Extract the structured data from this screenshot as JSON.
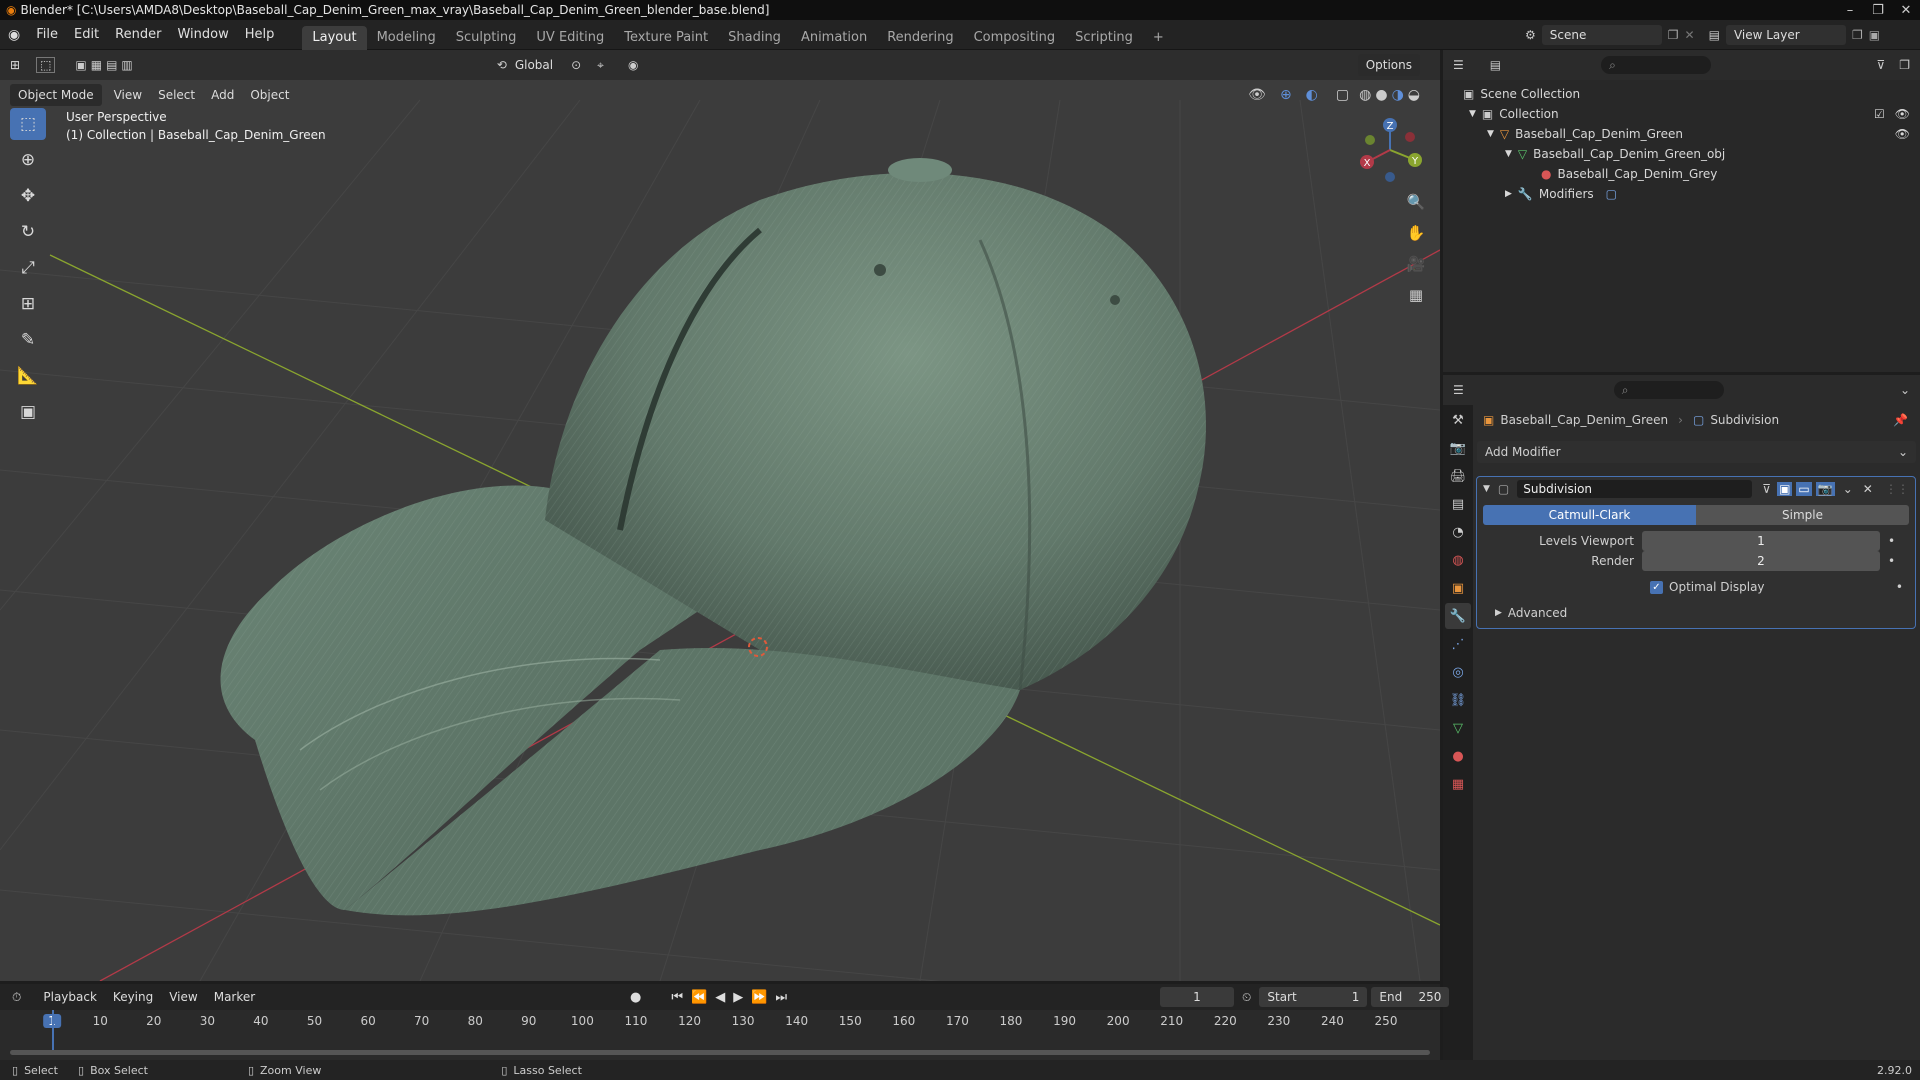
{
  "window": {
    "title": "Blender* [C:\\Users\\AMDA8\\Desktop\\Baseball_Cap_Denim_Green_max_vray\\Baseball_Cap_Denim_Green_blender_base.blend]",
    "controls": [
      "–",
      "❐",
      "✕"
    ]
  },
  "menu": {
    "items": [
      "File",
      "Edit",
      "Render",
      "Window",
      "Help"
    ]
  },
  "workspaces": {
    "tabs": [
      "Layout",
      "Modeling",
      "Sculpting",
      "UV Editing",
      "Texture Paint",
      "Shading",
      "Animation",
      "Rendering",
      "Compositing",
      "Scripting"
    ],
    "active": "Layout",
    "add_symbol": "+"
  },
  "scene": {
    "name": "Scene",
    "view_layer": "View Layer"
  },
  "viewport": {
    "mode": "Object Mode",
    "menus": [
      "View",
      "Select",
      "Add",
      "Object"
    ],
    "transform_orientation": "Global",
    "options_label": "Options",
    "overlay_title": "User Perspective",
    "overlay_subtitle": "(1) Collection | Baseball_Cap_Denim_Green",
    "gizmo": {
      "x": "X",
      "y": "Y",
      "z": "Z"
    },
    "colors": {
      "background": "#3c3c3c",
      "grid": "#464646",
      "x_axis": "#b23a48",
      "y_axis": "#8aa52f",
      "cap_fabric": "#6c8677",
      "active_blue": "#4772b3"
    }
  },
  "outliner": {
    "root": "Scene Collection",
    "collection": "Collection",
    "object": "Baseball_Cap_Denim_Green",
    "mesh": "Baseball_Cap_Denim_Green_obj",
    "material": "Baseball_Cap_Denim_Grey",
    "modifiers": "Modifiers"
  },
  "properties": {
    "breadcrumb_object": "Baseball_Cap_Denim_Green",
    "breadcrumb_modifier": "Subdivision",
    "add_modifier": "Add Modifier",
    "modifier": {
      "name": "Subdivision",
      "type_options": [
        "Catmull-Clark",
        "Simple"
      ],
      "active_type": "Catmull-Clark",
      "levels_viewport_label": "Levels Viewport",
      "levels_viewport": "1",
      "render_label": "Render",
      "render": "2",
      "optimal_display_label": "Optimal Display",
      "optimal_display": true,
      "advanced_label": "Advanced"
    }
  },
  "timeline": {
    "menus": [
      "Playback",
      "Keying",
      "View",
      "Marker"
    ],
    "current_frame": "1",
    "start_label": "Start",
    "start": "1",
    "end_label": "End",
    "end": "250",
    "ticks": [
      "1",
      "10",
      "20",
      "30",
      "40",
      "50",
      "60",
      "70",
      "80",
      "90",
      "100",
      "110",
      "120",
      "130",
      "140",
      "150",
      "160",
      "170",
      "180",
      "190",
      "200",
      "210",
      "220",
      "230",
      "240",
      "250"
    ]
  },
  "status": {
    "select": "Select",
    "box_select": "Box Select",
    "zoom_view": "Zoom View",
    "lasso_select": "Lasso Select",
    "version": "2.92.0"
  }
}
